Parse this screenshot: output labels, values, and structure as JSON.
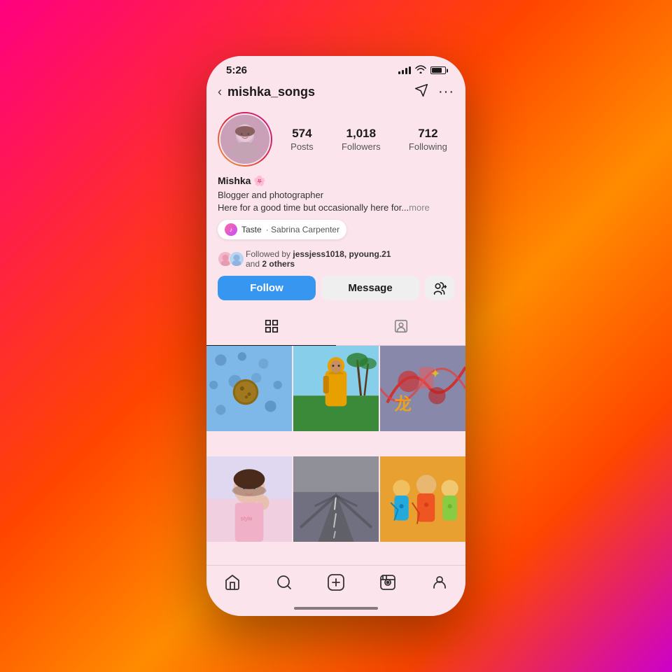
{
  "phone": {
    "statusBar": {
      "time": "5:26"
    },
    "header": {
      "backLabel": "‹",
      "username": "mishka_songs",
      "directIcon": "✈",
      "moreIcon": "···"
    },
    "profile": {
      "name": "Mishka 🌸",
      "bio1": "Blogger and photographer",
      "bio2": "Here for a good time but occasionally here for...",
      "bioMore": "more",
      "stats": {
        "posts": {
          "value": "574",
          "label": "Posts"
        },
        "followers": {
          "value": "1,018",
          "label": "Followers"
        },
        "following": {
          "value": "712",
          "label": "Following"
        }
      },
      "music": {
        "songTitle": "Taste",
        "artist": "Sabrina Carpenter"
      },
      "followedBy": {
        "text1": "jessjess1018, pyoung.21",
        "text2": "and",
        "othersCount": "2 others"
      },
      "buttons": {
        "follow": "Follow",
        "message": "Message"
      }
    },
    "tabs": {
      "grid": "⊞",
      "tagged": "👤"
    },
    "bottomNav": {
      "home": "⌂",
      "search": "🔍",
      "add": "⊕",
      "reels": "🎬",
      "profile": "👤"
    }
  }
}
